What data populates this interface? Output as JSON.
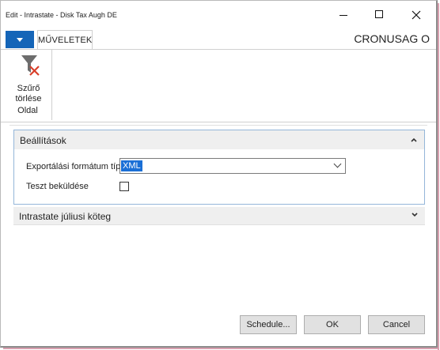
{
  "window": {
    "title": "Edit - Intrastate - Disk Tax Augh DE"
  },
  "ribbon": {
    "tabs": [
      {
        "label": "MŰVELETEK"
      }
    ],
    "company": "CRONUSAG O",
    "actions": [
      {
        "label_line1": "Szűrő",
        "label_line2": "törlése",
        "icon": "clear-filter-icon"
      }
    ],
    "group_label": "Oldal"
  },
  "fasttabs": [
    {
      "title": "Beállítások",
      "expanded": true,
      "fields": [
        {
          "label": "Exportálási formátum típusa",
          "value": "XML",
          "type": "select"
        },
        {
          "label": "Teszt beküldése",
          "value": false,
          "type": "checkbox"
        }
      ]
    },
    {
      "title": "Intrastate júliusi köteg",
      "expanded": false
    }
  ],
  "buttons": {
    "schedule": "Schedule...",
    "ok": "OK",
    "cancel": "Cancel"
  },
  "colors": {
    "accent": "#1565b8",
    "selection": "#1a6fd6",
    "fasttab_border": "#94b6d9"
  }
}
